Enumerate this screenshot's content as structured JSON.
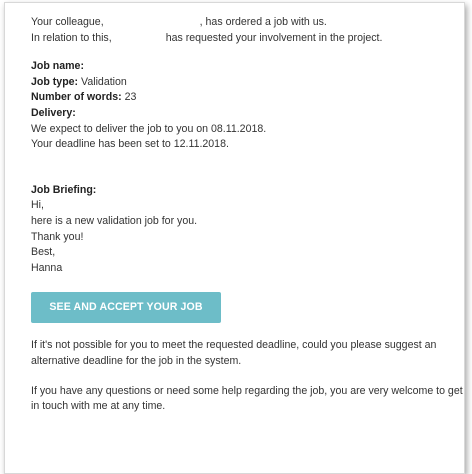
{
  "intro": {
    "line1_prefix": "Your colleague,",
    "line1_suffix": ", has ordered a job with us.",
    "line2_prefix": "In relation to this,",
    "line2_suffix": "has requested your involvement in the project."
  },
  "job": {
    "name_label": "Job name:",
    "name_value": "",
    "type_label": "Job type:",
    "type_value": "Validation",
    "words_label": "Number of words:",
    "words_value": "23",
    "delivery_label": "Delivery:",
    "delivery_line1": "We expect to deliver the job to you on 08.11.2018.",
    "delivery_line2": "Your deadline has been set to 12.11.2018."
  },
  "briefing": {
    "label": "Job Briefing:",
    "lines": [
      "Hi,",
      "here is a new validation job for you.",
      "Thank you!",
      "Best,",
      "Hanna"
    ]
  },
  "cta": {
    "label": "SEE AND ACCEPT YOUR JOB",
    "color": "#6dbdc8"
  },
  "footer": {
    "deadline_text": "If it's not possible for you to meet the requested deadline, could you please suggest an alternative deadline for the job in the system.",
    "help_text": "If you have any questions or need some help regarding the job, you are very welcome to get in touch with me at any time."
  }
}
